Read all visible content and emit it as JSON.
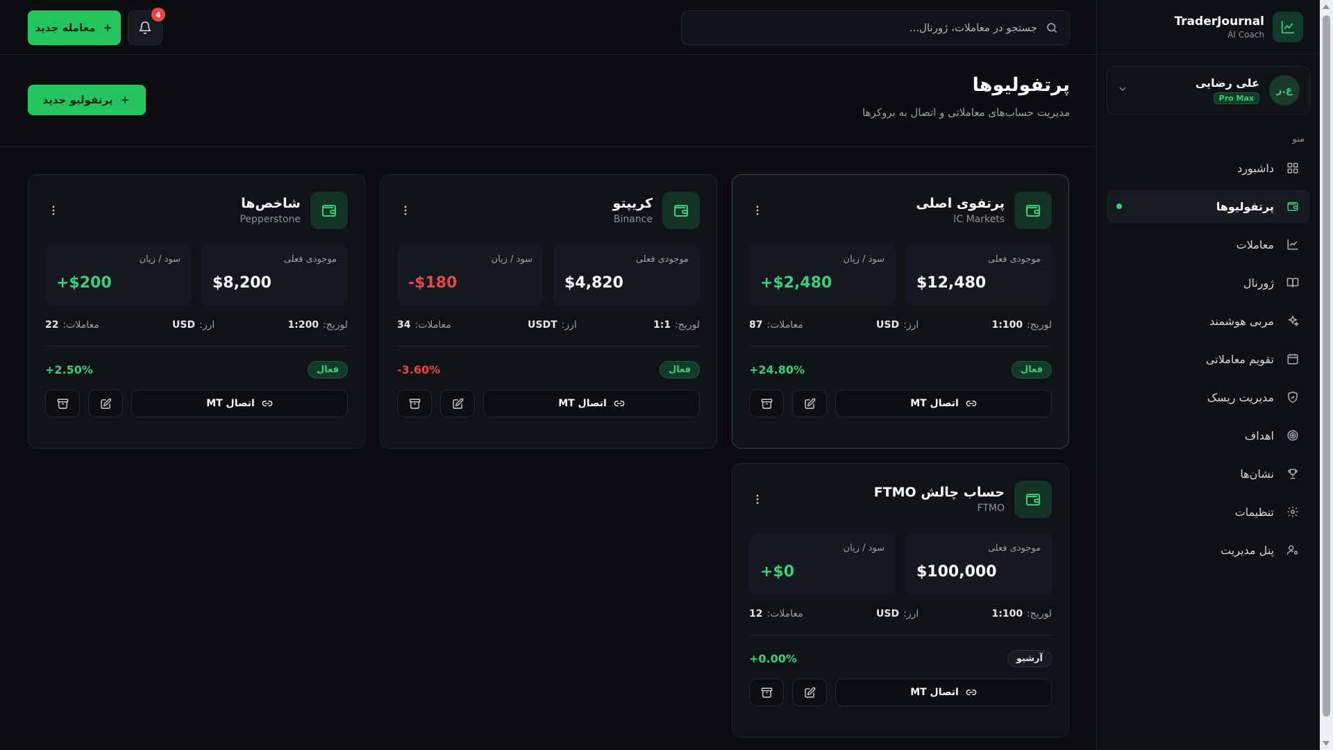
{
  "brand": {
    "name": "TraderJournal",
    "sub": "AI Coach"
  },
  "user": {
    "initials": "ع.ر",
    "name": "علی رضایی",
    "plan": "Pro Max"
  },
  "sidebar": {
    "menu_title": "منو",
    "items": [
      {
        "label": "داشبورد",
        "icon": "dashboard-icon"
      },
      {
        "label": "پرتفولیوها",
        "icon": "wallet-icon",
        "active": true
      },
      {
        "label": "معاملات",
        "icon": "chart-line-icon"
      },
      {
        "label": "ژورنال",
        "icon": "book-icon"
      },
      {
        "label": "مربی هوشمند",
        "icon": "sparkles-icon"
      },
      {
        "label": "تقویم معاملاتی",
        "icon": "calendar-icon"
      },
      {
        "label": "مدیریت ریسک",
        "icon": "shield-icon"
      },
      {
        "label": "اهداف",
        "icon": "target-icon"
      },
      {
        "label": "نشان‌ها",
        "icon": "trophy-icon"
      },
      {
        "label": "تنظیمات",
        "icon": "gear-icon"
      },
      {
        "label": "پنل مدیریت",
        "icon": "user-cog-icon"
      }
    ]
  },
  "topbar": {
    "search_placeholder": "جستجو در معاملات، ژورنال...",
    "notifications_count": "4",
    "new_trade_label": "معامله جدید"
  },
  "page": {
    "title": "پرتفولیوها",
    "subtitle": "مدیریت حساب‌های معاملاتی و اتصال به بروکرها",
    "new_portfolio_label": "پرتفولیو جدید"
  },
  "labels": {
    "balance": "موجودی فعلی",
    "pnl": "سود / زیان",
    "leverage": "لوریج:",
    "currency": "ارز:",
    "trades": "معاملات:",
    "connect": "اتصال MT"
  },
  "portfolios": [
    {
      "title": "پرتفوی اصلی",
      "broker": "IC Markets",
      "balance": "$12,480",
      "pnl": "+$2,480",
      "pnl_tone": "green",
      "leverage": "1:100",
      "currency": "USD",
      "trades": "87",
      "status": "فعال",
      "status_type": "active",
      "pct": "+24.80%",
      "pct_tone": "green",
      "highlight": true
    },
    {
      "title": "کریپتو",
      "broker": "Binance",
      "balance": "$4,820",
      "pnl": "-$180",
      "pnl_tone": "red",
      "leverage": "1:1",
      "currency": "USDT",
      "trades": "34",
      "status": "فعال",
      "status_type": "active",
      "pct": "-3.60%",
      "pct_tone": "red",
      "highlight": false
    },
    {
      "title": "شاخص‌ها",
      "broker": "Pepperstone",
      "balance": "$8,200",
      "pnl": "+$200",
      "pnl_tone": "green",
      "leverage": "1:200",
      "currency": "USD",
      "trades": "22",
      "status": "فعال",
      "status_type": "active",
      "pct": "+2.50%",
      "pct_tone": "green",
      "highlight": false
    },
    {
      "title": "حساب چالش FTMO",
      "broker": "FTMO",
      "balance": "$100,000",
      "pnl": "+$0",
      "pnl_tone": "green",
      "leverage": "1:100",
      "currency": "USD",
      "trades": "12",
      "status": "آرشیو",
      "status_type": "archived",
      "pct": "+0.00%",
      "pct_tone": "green",
      "highlight": false
    }
  ],
  "colors": {
    "accent": "#22c55e",
    "profit": "#34d27b",
    "loss": "#ef4444",
    "background": "#0b0d11"
  }
}
